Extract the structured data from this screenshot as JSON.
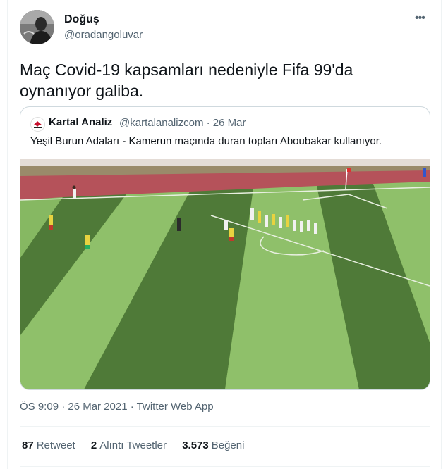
{
  "tweet": {
    "author_name": "Doğuş",
    "author_handle": "@oradangoluvar",
    "text": "Maç Covid-19 kapsamları nedeniyle Fifa 99'da oynanıyor galiba.",
    "timestamp": "ÖS 9:09 · 26 Mar 2021",
    "separator": " · ",
    "source": "Twitter Web App"
  },
  "quoted": {
    "author_name": "Kartal Analiz",
    "author_meta": "@kartalanalizcom · 26 Mar",
    "text": "Yeşil Burun Adaları - Kamerun maçında duran topları Aboubakar kullanıyor."
  },
  "stats": [
    {
      "count": "87",
      "label": "Retweet"
    },
    {
      "count": "2",
      "label": "Alıntı Tweetler"
    },
    {
      "count": "3.573",
      "label": "Beğeni"
    }
  ],
  "icons": {
    "more": "more-horizontal-icon"
  },
  "colors": {
    "text": "#0f1419",
    "secondary": "#536471",
    "border": "#cfd9de",
    "pitch_light": "#8fc06a",
    "pitch_dark": "#4f7a38",
    "track": "#b5525a"
  }
}
